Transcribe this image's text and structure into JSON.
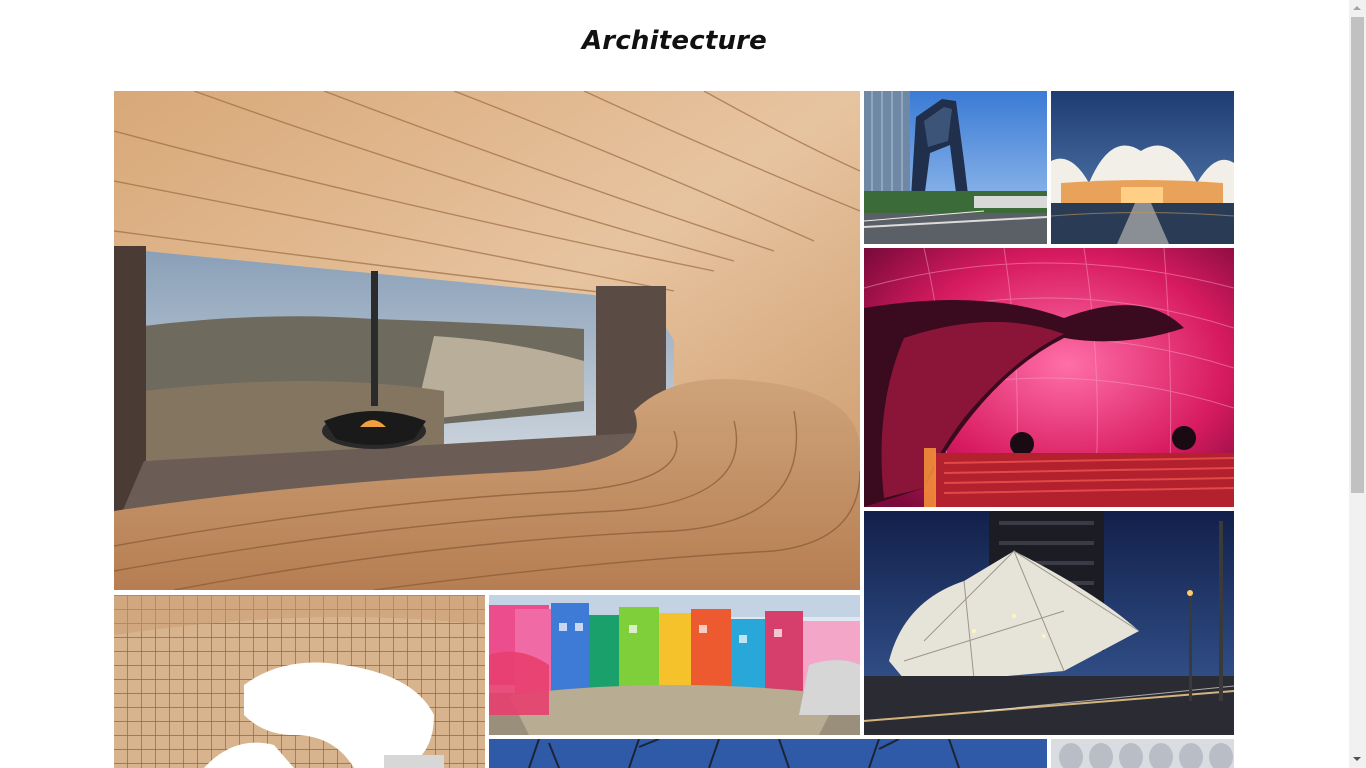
{
  "page": {
    "title": "Architecture"
  },
  "gallery": {
    "items": [
      {
        "name": "wooden-lounge-photo",
        "icon": "photo"
      },
      {
        "name": "cctv-tower-photo",
        "icon": "photo"
      },
      {
        "name": "white-wave-chapel-photo",
        "icon": "photo"
      },
      {
        "name": "pink-inflatable-hall-photo",
        "icon": "photo"
      },
      {
        "name": "metropol-parasol-photo",
        "icon": "photo"
      },
      {
        "name": "favela-painting-photo",
        "icon": "photo"
      },
      {
        "name": "angular-pavilion-night-photo",
        "icon": "photo"
      },
      {
        "name": "winter-trees-photo",
        "icon": "photo"
      },
      {
        "name": "white-facade-photo",
        "icon": "photo"
      }
    ]
  },
  "colors": {
    "background": "#ffffff",
    "title": "#111111",
    "scrollbar_track": "#f1f1f1",
    "scrollbar_thumb": "#c1c1c1"
  }
}
